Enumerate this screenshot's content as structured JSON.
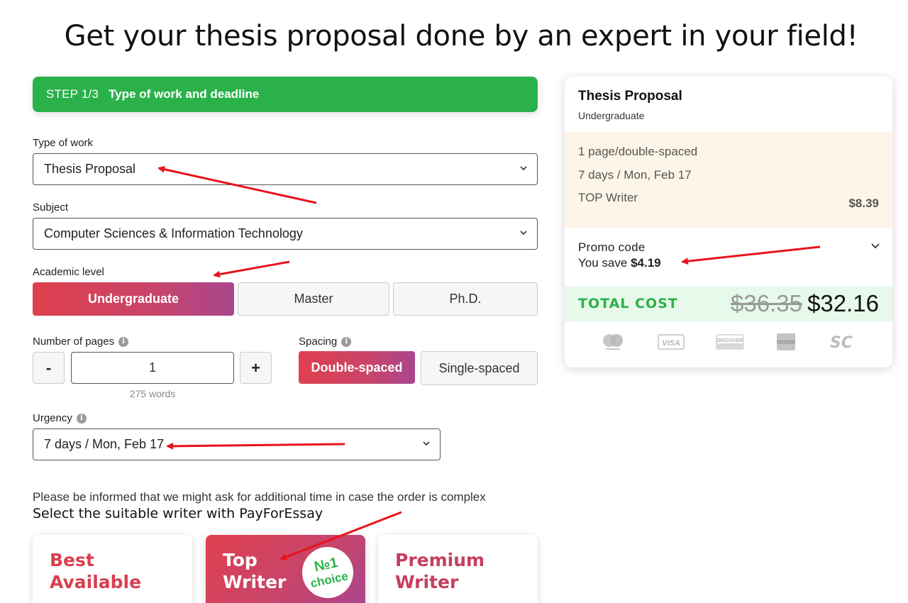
{
  "headline": "Get your thesis proposal done by an expert in your field!",
  "step": {
    "number": "STEP 1/3",
    "title": "Type of work and deadline"
  },
  "type_of_work": {
    "label": "Type of work",
    "value": "Thesis Proposal"
  },
  "subject": {
    "label": "Subject",
    "value": "Computer Sciences & Information Technology"
  },
  "academic_level": {
    "label": "Academic level",
    "options": [
      "Undergraduate",
      "Master",
      "Ph.D."
    ],
    "selected": "Undergraduate"
  },
  "pages": {
    "label": "Number of pages",
    "info": "i",
    "minus": "-",
    "plus": "+",
    "value": "1",
    "words": "275 words"
  },
  "spacing": {
    "label": "Spacing",
    "info": "i",
    "options": [
      "Double-spaced",
      "Single-spaced"
    ],
    "selected": "Double-spaced"
  },
  "urgency": {
    "label": "Urgency",
    "info": "i",
    "value": "7 days / Mon, Feb 17"
  },
  "note": "Please be informed that we might ask for additional time in case the order is complex",
  "writer_section_title": "Select the suitable writer with PayForEssay",
  "writers": [
    {
      "line1": "Best",
      "line2": "Available"
    },
    {
      "line1": "Top",
      "line2": "Writer",
      "badge_line1": "№1",
      "badge_line2": "choice"
    },
    {
      "line1": "Premium",
      "line2": "Writer"
    }
  ],
  "summary": {
    "title": "Thesis Proposal",
    "level": "Undergraduate",
    "details": [
      "1 page/double-spaced",
      "7 days / Mon, Feb 17",
      "TOP Writer"
    ],
    "writer_price": "$8.39",
    "promo_label": "Promo code",
    "save_prefix": "You save",
    "save_amount": "$4.19",
    "total_label": "TOTAL COST",
    "old_price": "$36.35",
    "new_price": "$32.16",
    "payment_icons": [
      "mastercard-icon",
      "visa-icon",
      "discover-icon",
      "amex-icon",
      "sc-icon"
    ]
  },
  "colors": {
    "green": "#2bb14a",
    "gradient_start": "#e0404e",
    "gradient_end": "#a9468e",
    "annotation_arrow": "#e8141b"
  }
}
